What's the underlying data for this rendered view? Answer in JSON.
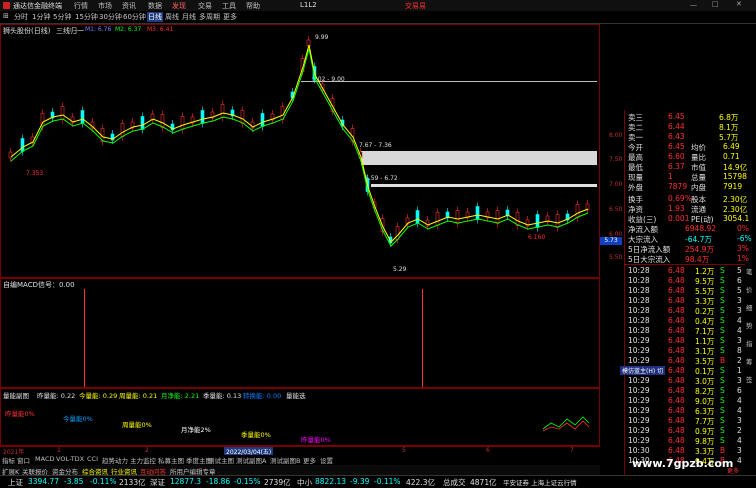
{
  "titlebar": {
    "app_title": "通达信金融终端",
    "menus": [
      "行情",
      "市场",
      "资讯",
      "数据",
      "发现",
      "交易",
      "工具",
      "帮助",
      "L1L2"
    ],
    "trade_link": "交易易"
  },
  "periods": {
    "items": [
      "分时",
      "1分钟",
      "5分钟",
      "15分钟",
      "30分钟",
      "60分钟",
      "日线",
      "周线",
      "月线",
      "多周期",
      "更多"
    ],
    "active": "日线"
  },
  "chart_header": {
    "stock": "狮头股份(日线)",
    "indicator": "三线归一",
    "ma1": "M1: 6.76",
    "ma2": "M2: 6.37",
    "ma3": "M3: 6.41"
  },
  "price_axis": [
    "8.00",
    "7.50",
    "7.00",
    "6.50",
    "6.00",
    "5.50"
  ],
  "price_marker": "5.73",
  "annotations": {
    "high": "9.99",
    "r1": "9.02 - 9.00",
    "r2": "7.67 - 7.36",
    "r3": "6.59 - 6.72",
    "low": "5.29",
    "left_low": "7.353",
    "tail_low": "6.160"
  },
  "macd_header": "自编MACD信号：0.00",
  "volume_header": {
    "name": "量能副图",
    "items": [
      {
        "label": "昨量能: 0.22",
        "color": "#e0e0e0"
      },
      {
        "label": "今量能: 0.29",
        "color": "#ffff00"
      },
      {
        "label": "周量能: 0.21",
        "color": "#ffff00"
      },
      {
        "label": "月净能: 2.21",
        "color": "#00ff00"
      },
      {
        "label": "季量能: 0.13",
        "color": "#e0e0e0"
      },
      {
        "label": "转换能: 0.00",
        "color": "#0080ff"
      },
      {
        "label": "量能选",
        "color": "#e0e0e0"
      }
    ]
  },
  "volume_labels": [
    {
      "text": "昨量能0%",
      "color": "#ff3030"
    },
    {
      "text": "今量能0%",
      "color": "#00a0ff"
    },
    {
      "text": "周量能0%",
      "color": "#ffff00"
    },
    {
      "text": "月净能2%",
      "color": "#ffffff"
    },
    {
      "text": "季量能0%",
      "color": "#ffff00"
    },
    {
      "text": "昨量能0%",
      "color": "#ff00ff"
    }
  ],
  "timeline": {
    "labels": [
      "2021年",
      "1",
      "2",
      "2022/03/04(五)",
      "5",
      "6",
      "7"
    ],
    "end": "8"
  },
  "bottom_tabs": [
    "指标",
    "窗口",
    "MACD",
    "VOL-TDX",
    "CCI",
    "趋势动力",
    "主力监控",
    "私募主图",
    "季度主图",
    "测试主图",
    "测试副图A",
    "测试副图B",
    "更多",
    "设置"
  ],
  "quote": {
    "sell_levels": [
      {
        "label": "卖三",
        "price": "6.45",
        "vol": "6.8万"
      },
      {
        "label": "卖二",
        "price": "6.44",
        "vol": "8.1万"
      },
      {
        "label": "卖一",
        "price": "6.43",
        "vol": "5.7万"
      }
    ],
    "stats": [
      {
        "l1": "今开",
        "v1": "6.45",
        "l2": "均价",
        "v2": "6.49"
      },
      {
        "l1": "最高",
        "v1": "6.60",
        "l2": "量比",
        "v2": "0.71"
      },
      {
        "l1": "最低",
        "v1": "6.37",
        "l2": "市值",
        "v2": "14.9亿"
      },
      {
        "l1": "现量",
        "v1": "1",
        "l2": "总量",
        "v2": "15798"
      },
      {
        "l1": "外盘",
        "v1": "7879",
        "l2": "内盘",
        "v2": "7919"
      },
      {
        "l1": "换手",
        "v1": "0.69%",
        "l2": "股本",
        "v2": "2.30亿"
      },
      {
        "l1": "净资",
        "v1": "1.93",
        "l2": "流通",
        "v2": "2.30亿"
      },
      {
        "l1": "收益(三)",
        "v1": "0.001",
        "l2": "PE(动)",
        "v2": "3054.1"
      }
    ],
    "flows": [
      {
        "label": "净流入额",
        "value": "6948.92",
        "pct": "0%"
      },
      {
        "label": "大宗流入",
        "value": "-64.7万",
        "pct": "-6%"
      },
      {
        "label": "5日净流入额",
        "value": "254.9万",
        "pct": "3%"
      },
      {
        "label": "5日大宗流入",
        "value": "98.4万",
        "pct": "1%"
      }
    ]
  },
  "trades": [
    {
      "time": "10:28",
      "price": "6.48",
      "vol": "1.2万",
      "side": "S",
      "n": "5"
    },
    {
      "time": "10:28",
      "price": "6.48",
      "vol": "9.5万",
      "side": "S",
      "n": "6"
    },
    {
      "time": "10:28",
      "price": "6.48",
      "vol": "5.5万",
      "side": "S",
      "n": "5"
    },
    {
      "time": "10:28",
      "price": "6.48",
      "vol": "3.3万",
      "side": "S",
      "n": "3"
    },
    {
      "time": "10:28",
      "price": "6.48",
      "vol": "0.2万",
      "side": "S",
      "n": "3"
    },
    {
      "time": "10:28",
      "price": "6.48",
      "vol": "0.4万",
      "side": "S",
      "n": "4"
    },
    {
      "time": "10:28",
      "price": "6.48",
      "vol": "7.1万",
      "side": "S",
      "n": "4"
    },
    {
      "time": "10:29",
      "price": "6.48",
      "vol": "1.1万",
      "side": "S",
      "n": "3"
    },
    {
      "time": "10:29",
      "price": "6.48",
      "vol": "3.1万",
      "side": "S",
      "n": "8"
    },
    {
      "time": "10:29",
      "price": "6.48",
      "vol": "3.5万",
      "side": "B",
      "n": "2"
    },
    {
      "time": "10:29",
      "price": "6.48",
      "vol": "0.1万",
      "side": "S",
      "n": "1"
    },
    {
      "time": "10:29",
      "price": "6.48",
      "vol": "3.0万",
      "side": "S",
      "n": "3"
    },
    {
      "time": "10:29",
      "price": "6.48",
      "vol": "8.2万",
      "side": "S",
      "n": "6"
    },
    {
      "time": "10:29",
      "price": "6.48",
      "vol": "9.0万",
      "side": "S",
      "n": "4"
    },
    {
      "time": "10:29",
      "price": "6.48",
      "vol": "6.3万",
      "side": "S",
      "n": "4"
    },
    {
      "time": "10:29",
      "price": "6.48",
      "vol": "7.7万",
      "side": "S",
      "n": "3"
    },
    {
      "time": "10:29",
      "price": "6.48",
      "vol": "0.9万",
      "side": "S",
      "n": "2"
    },
    {
      "time": "10:29",
      "price": "6.48",
      "vol": "9.8万",
      "side": "S",
      "n": "4"
    },
    {
      "time": "10:30",
      "price": "6.48",
      "vol": "3.3万",
      "side": "B",
      "n": "3"
    },
    {
      "time": "10:30",
      "price": "6.48",
      "vol": "9.4万",
      "side": "B",
      "n": "4"
    }
  ],
  "right_tabs": [
    "笔",
    "价",
    "细",
    "势",
    "指",
    "筹",
    "签"
  ],
  "right_bottom": "更多",
  "bottom_links": [
    "扩展K",
    "关联报价",
    "资金分布",
    "综合资讯",
    "行业资讯",
    "互动问答",
    "所用户编辑专章"
  ],
  "window_overlay": "模仿蓝主(H) 切",
  "statusbar": {
    "sh": {
      "name": "上证",
      "value": "3394.77",
      "chg": "-3.85",
      "pct": "-0.11%",
      "amt": "2133亿"
    },
    "sz": {
      "name": "深证",
      "value": "12877.3",
      "chg": "-18.86",
      "pct": "-0.15%",
      "amt": "2739亿"
    },
    "zx": {
      "name": "中小",
      "value": "8822.13",
      "chg": "-9.39",
      "pct": "-0.11%",
      "amt": "422.3亿"
    },
    "extra": "总成交",
    "extra_value": "4871亿",
    "ticker": "平安证券 上海上证云行情"
  },
  "watermark": "www.7gpzb.com",
  "colors": {
    "up": "#ff3030",
    "down": "#00ffff",
    "ma_green": "#00ff00",
    "ma_yellow": "#ffff00",
    "border": "#7a0000"
  }
}
